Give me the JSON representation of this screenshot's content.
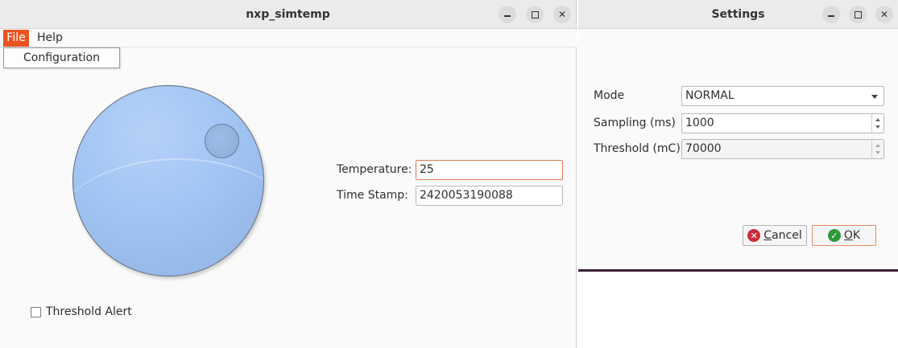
{
  "main_window": {
    "title": "nxp_simtemp",
    "menu": {
      "file": "File",
      "help": "Help"
    },
    "file_menu_items": [
      "Configuration"
    ],
    "temperature_label": "Temperature:",
    "temperature_value": "25",
    "timestamp_label": "Time Stamp:",
    "timestamp_value": "2420053190088",
    "threshold_alert_label": "Threshold Alert",
    "threshold_alert_checked": false,
    "window_buttons": {
      "minimize": "minimize-icon",
      "maximize": "maximize-icon",
      "close": "✕"
    }
  },
  "settings_window": {
    "title": "Settings",
    "mode_label": "Mode",
    "mode_value": "NORMAL",
    "sampling_label": "Sampling (ms)",
    "sampling_value": "1000",
    "threshold_label": "Threshold (mC)",
    "threshold_value": "70000",
    "cancel_button": {
      "underlined": "C",
      "rest": "ancel"
    },
    "ok_button": {
      "underlined": "O",
      "rest": "K"
    },
    "window_buttons": {
      "close": "✕"
    }
  },
  "colors": {
    "accent": "#e95420",
    "dial": "#a4c6f4",
    "cancel_icon": "#cc2d3b",
    "ok_icon": "#2e9a3a"
  }
}
